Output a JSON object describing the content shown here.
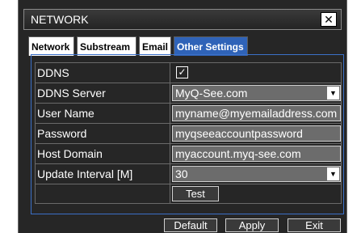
{
  "window": {
    "title": "NETWORK",
    "close_label": "✕"
  },
  "tabs": [
    {
      "label": "Network"
    },
    {
      "label": "Substream"
    },
    {
      "label": "Email"
    },
    {
      "label": "Other Settings"
    }
  ],
  "active_tab": "Other Settings",
  "form": {
    "ddns": {
      "label": "DDNS",
      "checked": true,
      "check_glyph": "✓"
    },
    "ddns_server": {
      "label": "DDNS Server",
      "value": "MyQ-See.com"
    },
    "user_name": {
      "label": "User Name",
      "value": "myname@myemailaddress.com"
    },
    "password": {
      "label": "Password",
      "value": "myqseeaccountpassword"
    },
    "host_domain": {
      "label": "Host Domain",
      "value": "myaccount.myq-see.com"
    },
    "update_interval": {
      "label": "Update Interval [M]",
      "value": "30"
    },
    "test_label": "Test"
  },
  "footer": {
    "default_label": "Default",
    "apply_label": "Apply",
    "exit_label": "Exit"
  },
  "icons": {
    "dropdown": "▼"
  },
  "colors": {
    "active_tab": "#2f63b8",
    "panel_border": "#3b70c8",
    "background": "#262626"
  }
}
